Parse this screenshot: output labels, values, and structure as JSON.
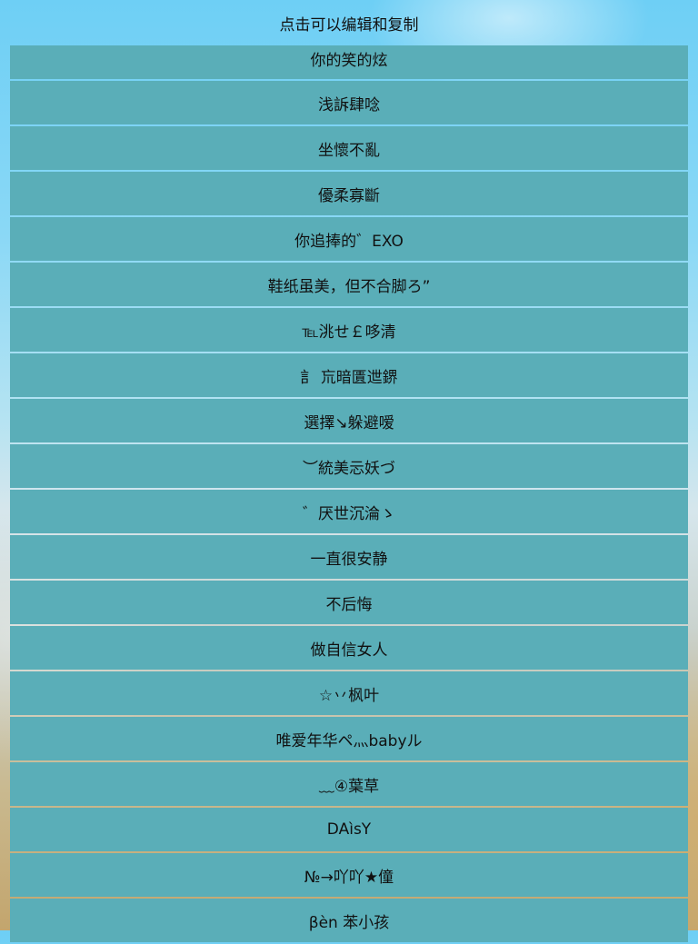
{
  "header": {
    "title": "点击可以编辑和复制"
  },
  "items": [
    "你的笑的炫",
    "浅訴肆唸",
    "坐懷不亂",
    "優柔寡斷",
    "你追捧的゛EXO",
    "鞋纸虽美，但不合脚ろ”",
    "℡洮せ￡哆清",
    "訁 巟暗匱迣鎅",
    "選擇↘躲避嗳",
    "︶統美忈妖づ",
    "゛厌世沉淪ゝ",
    "一直很安静",
    "不后悔",
    "做自信女人",
    "☆丷枫叶",
    "唯爱年华ペ灬babyル",
    "﹏④葉草",
    "DAìsY",
    "№→吖吖★僮",
    "βèn 苯小孩"
  ]
}
